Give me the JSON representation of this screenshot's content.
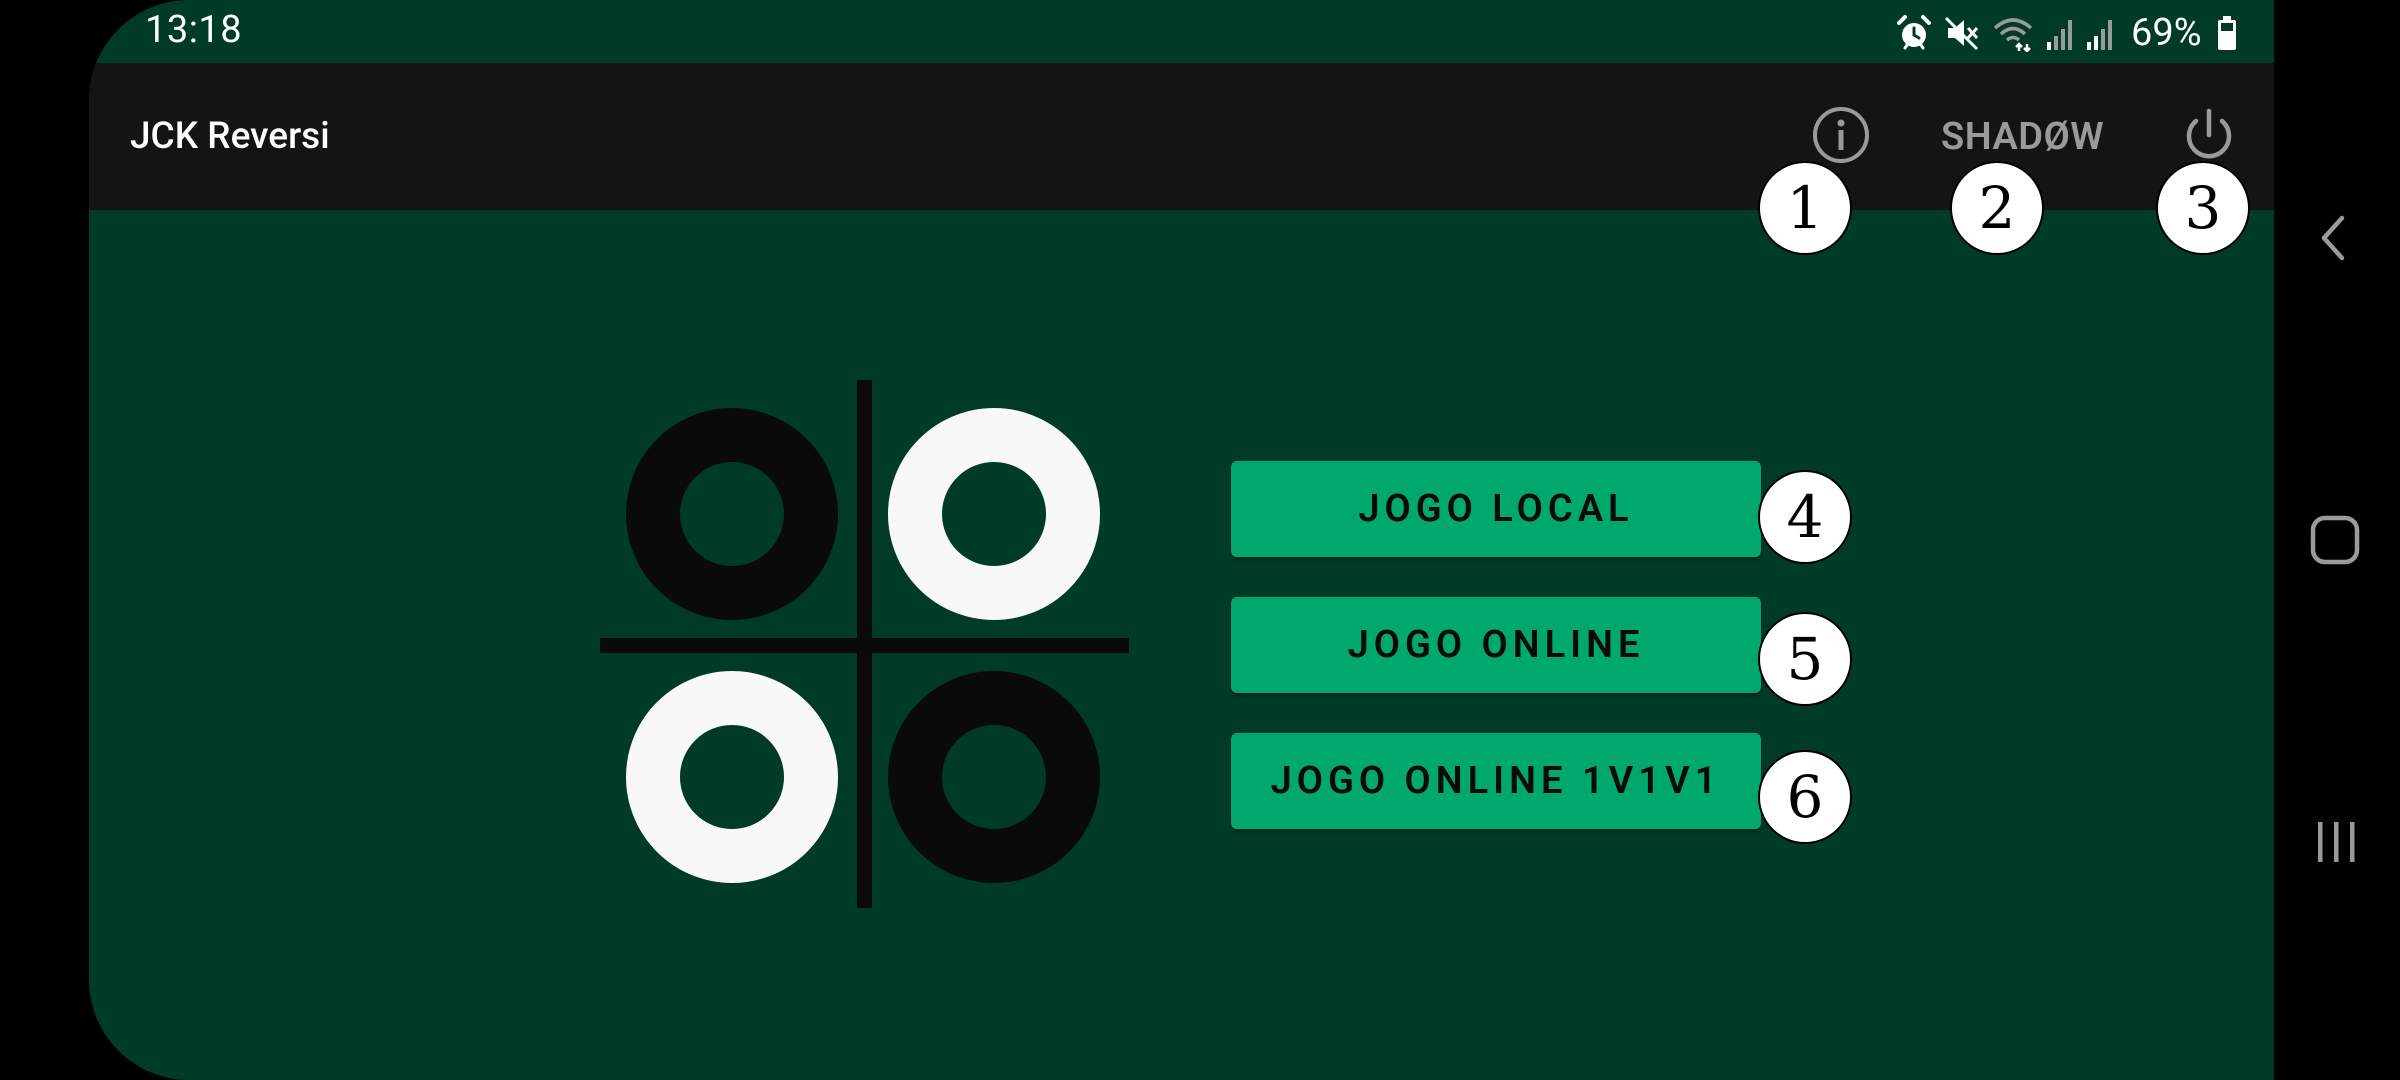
{
  "status_bar": {
    "time": "13:18",
    "battery": "69%",
    "icons": [
      "alarm-icon",
      "mute-icon",
      "wifi-icon",
      "signal-icon",
      "signal-icon",
      "battery-icon"
    ]
  },
  "app_bar": {
    "title": "JCK Reversi",
    "info_icon": "info-icon",
    "shadow_label": "SHADØW",
    "power_icon": "power-icon"
  },
  "menu": {
    "local": "JOGO LOCAL",
    "online": "JOGO ONLINE",
    "online_3p": "JOGO ONLINE 1V1V1"
  },
  "markers": [
    "1",
    "2",
    "3",
    "4",
    "5",
    "6"
  ],
  "nav_bar": {
    "icons": [
      "back-icon",
      "home-icon",
      "recents-icon"
    ]
  },
  "colors": {
    "background": "#003b28",
    "app_bar": "#141414",
    "button": "#00a86b",
    "white_piece": "#f8f8f8",
    "black_piece": "#0a0a0a"
  }
}
